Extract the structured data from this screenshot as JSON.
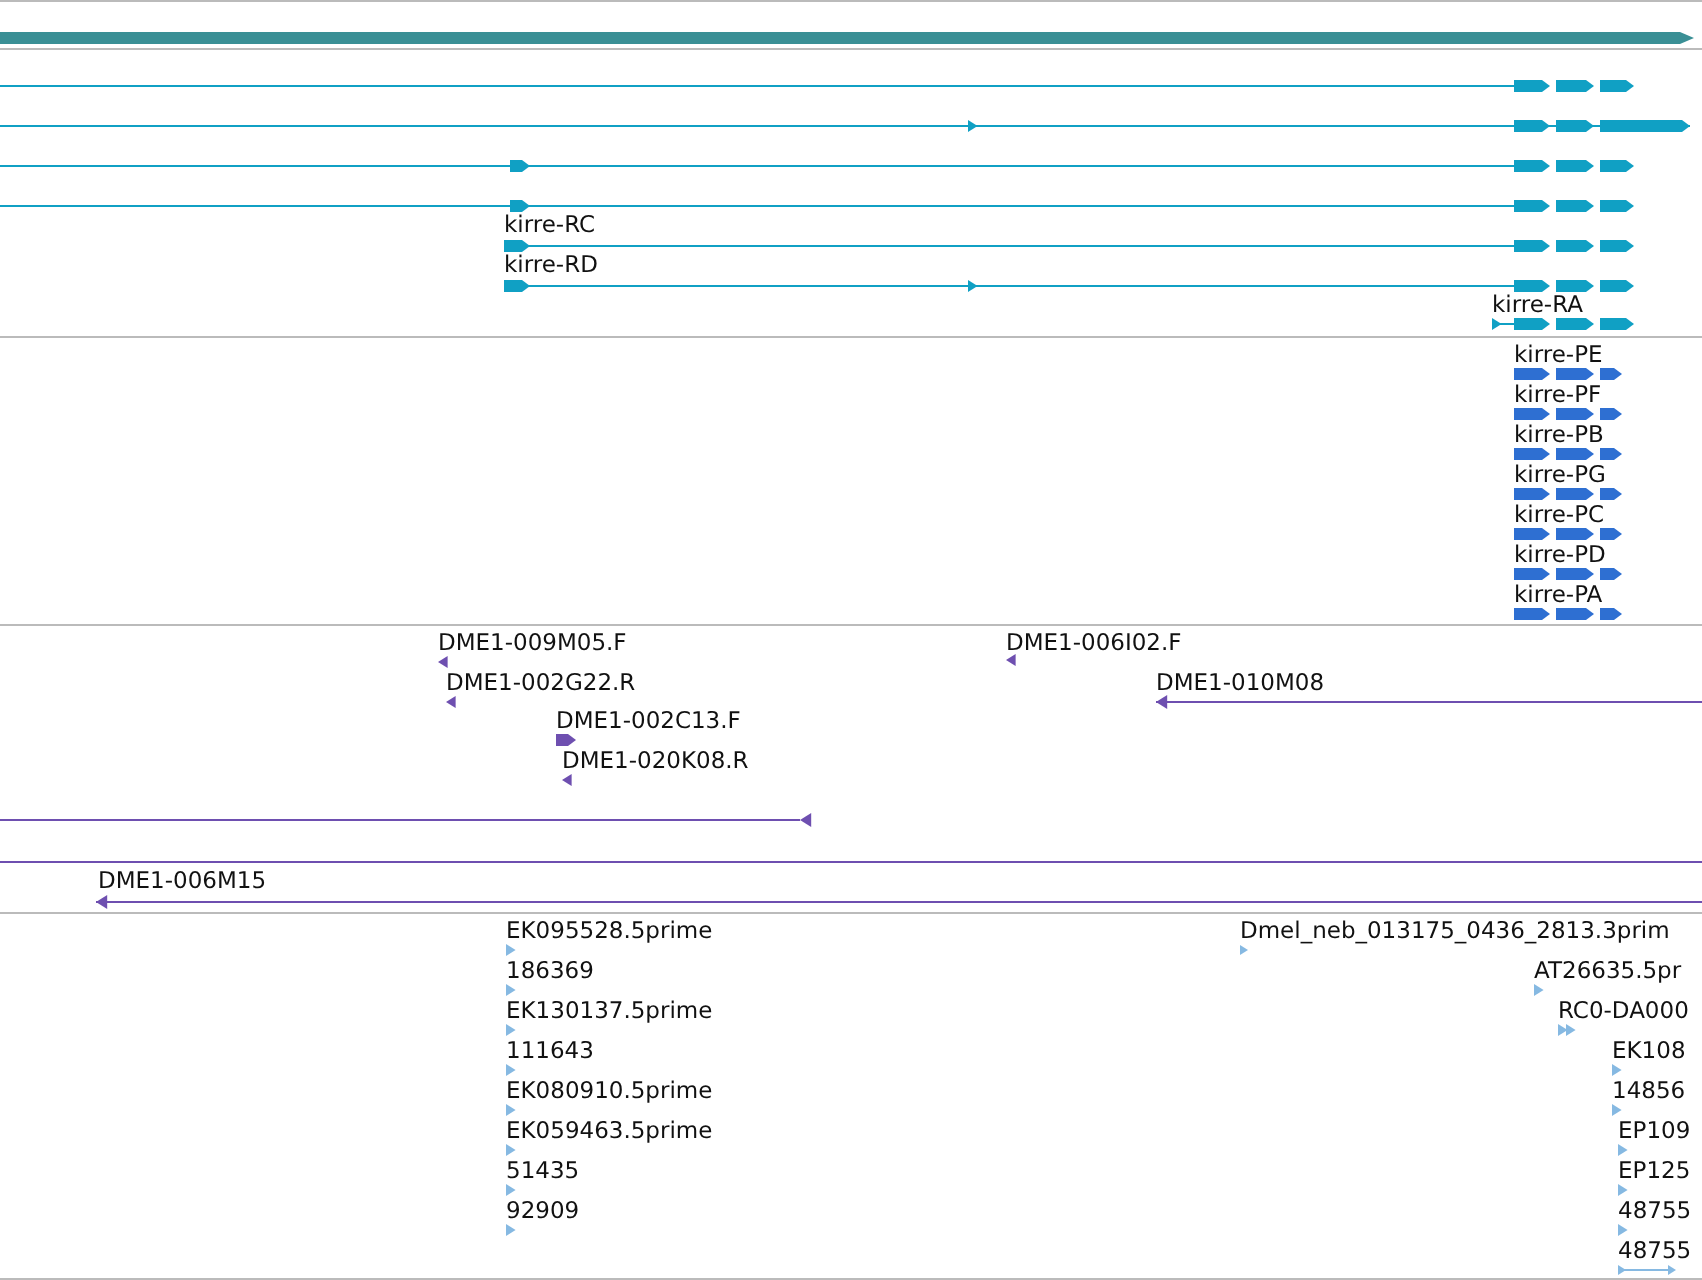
{
  "tracks": [
    {
      "kind": "transcript",
      "features": [
        {
          "label": "kirre-RC"
        },
        {
          "label": "kirre-RD"
        },
        {
          "label": "kirre-RA"
        }
      ]
    },
    {
      "kind": "protein",
      "features": [
        {
          "label": "kirre-PE"
        },
        {
          "label": "kirre-PF"
        },
        {
          "label": "kirre-PB"
        },
        {
          "label": "kirre-PG"
        },
        {
          "label": "kirre-PC"
        },
        {
          "label": "kirre-PD"
        },
        {
          "label": "kirre-PA"
        }
      ]
    },
    {
      "kind": "clone",
      "features": [
        {
          "label": "DME1-009M05.F"
        },
        {
          "label": "DME1-002G22.R"
        },
        {
          "label": "DME1-002C13.F"
        },
        {
          "label": "DME1-020K08.R"
        },
        {
          "label": "DME1-006I02.F"
        },
        {
          "label": "DME1-010M08"
        },
        {
          "label": "DME1-006M15"
        }
      ]
    },
    {
      "kind": "est",
      "features": [
        {
          "label": "EK095528.5prime"
        },
        {
          "label": "186369"
        },
        {
          "label": "EK130137.5prime"
        },
        {
          "label": "111643"
        },
        {
          "label": "EK080910.5prime"
        },
        {
          "label": "EK059463.5prime"
        },
        {
          "label": "51435"
        },
        {
          "label": "92909"
        },
        {
          "label": "Dmel_neb_013175_0436_2813.3prim"
        },
        {
          "label": "AT26635.5pr"
        },
        {
          "label": "RC0-DA000"
        },
        {
          "label": "EK108"
        },
        {
          "label": "14856"
        },
        {
          "label": "EP109"
        },
        {
          "label": "EP125"
        },
        {
          "label": "48755"
        },
        {
          "label": "48755"
        }
      ]
    }
  ]
}
